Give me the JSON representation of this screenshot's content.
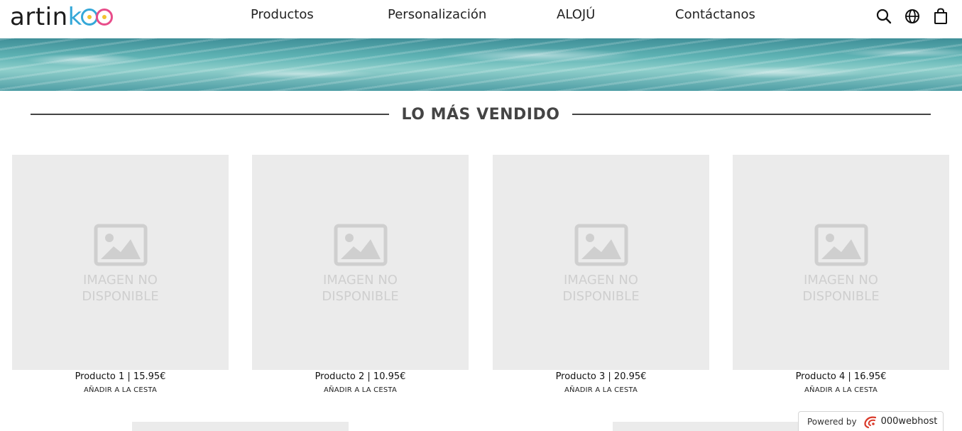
{
  "brand": {
    "logo_prefix": "artin",
    "logo_ko": "k"
  },
  "nav": [
    {
      "label": "Productos"
    },
    {
      "label": "Personalización"
    },
    {
      "label": "ALOJÚ"
    },
    {
      "label": "Contáctanos"
    }
  ],
  "header_icons": [
    "search-icon",
    "globe-icon",
    "shopping-bag-icon"
  ],
  "section": {
    "title": "LO MÁS VENDIDO"
  },
  "products": [
    {
      "name": "Producto 1 | 15.95€",
      "placeholder_line1": "IMAGEN NO",
      "placeholder_line2": "DISPONIBLE",
      "add_label": "AÑADIR A LA CESTA"
    },
    {
      "name": "Producto 2 | 10.95€",
      "placeholder_line1": "IMAGEN NO",
      "placeholder_line2": "DISPONIBLE",
      "add_label": "AÑADIR A LA CESTA"
    },
    {
      "name": "Producto 3 | 20.95€",
      "placeholder_line1": "IMAGEN NO",
      "placeholder_line2": "DISPONIBLE",
      "add_label": "AÑADIR A LA CESTA"
    },
    {
      "name": "Producto 4 | 16.95€",
      "placeholder_line1": "IMAGEN NO",
      "placeholder_line2": "DISPONIBLE",
      "add_label": "AÑADIR A LA CESTA"
    }
  ],
  "badge": {
    "label": "Powered by",
    "brand": "000webhost"
  },
  "colors": {
    "logo_accent": "#35a8d8",
    "placeholder_bg": "#ebebeb",
    "placeholder_fg": "#cfcfcf",
    "banner": "#5fb3b4"
  }
}
